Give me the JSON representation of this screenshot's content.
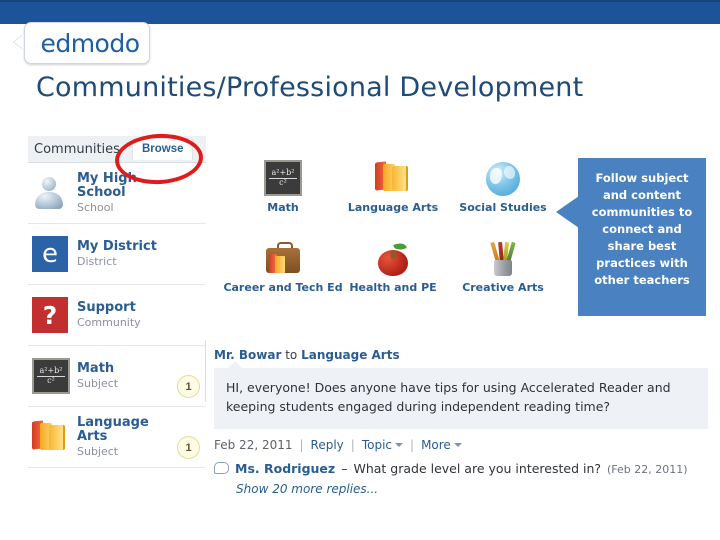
{
  "header": {
    "logo_text": "edmodo",
    "bar_color": "#1d5499"
  },
  "page_title": "Communities/Professional Development",
  "sidebar": {
    "title": "Communities",
    "tab_label": "Browse",
    "items": [
      {
        "name": "My High School",
        "type": "School",
        "icon": "person-icon",
        "badge": ""
      },
      {
        "name": "My District",
        "type": "District",
        "icon": "edmodo-e-icon",
        "badge": ""
      },
      {
        "name": "Support",
        "type": "Community",
        "icon": "question-mark-icon",
        "badge": ""
      },
      {
        "name": "Math",
        "type": "Subject",
        "icon": "chalkboard-icon",
        "badge": "1"
      },
      {
        "name": "Language Arts",
        "type": "Subject",
        "icon": "books-icon",
        "badge": "1"
      }
    ]
  },
  "subjects": [
    {
      "label": "Math",
      "icon": "chalkboard-icon"
    },
    {
      "label": "Language Arts",
      "icon": "books-icon"
    },
    {
      "label": "Social Studies",
      "icon": "globe-icon"
    },
    {
      "label": "Career and Tech Ed",
      "icon": "briefcase-icon"
    },
    {
      "label": "Health and PE",
      "icon": "apple-icon"
    },
    {
      "label": "Creative Arts",
      "icon": "pencil-cup-icon"
    }
  ],
  "callout": {
    "text": "Follow subject and content communities to connect and share best practices with other teachers",
    "color": "#4a81c0"
  },
  "annotation": {
    "shape": "ellipse",
    "target": "Browse",
    "color": "#e01b1b"
  },
  "post": {
    "author": "Mr. Bowar",
    "preposition": "to",
    "group": "Language Arts",
    "body": "HI, everyone! Does anyone have tips for using Accelerated Reader and keeping students engaged during independent reading time?",
    "date": "Feb 22, 2011",
    "actions": [
      "Reply",
      "Topic",
      "More"
    ],
    "reply": {
      "author": "Ms. Rodriguez",
      "dash": "–",
      "text": "What grade level are you interested in?",
      "date": "(Feb 22, 2011)"
    },
    "show_more": "Show 20 more replies..."
  },
  "math_icon": {
    "numerator": "a²+b²",
    "denominator": "c²"
  }
}
